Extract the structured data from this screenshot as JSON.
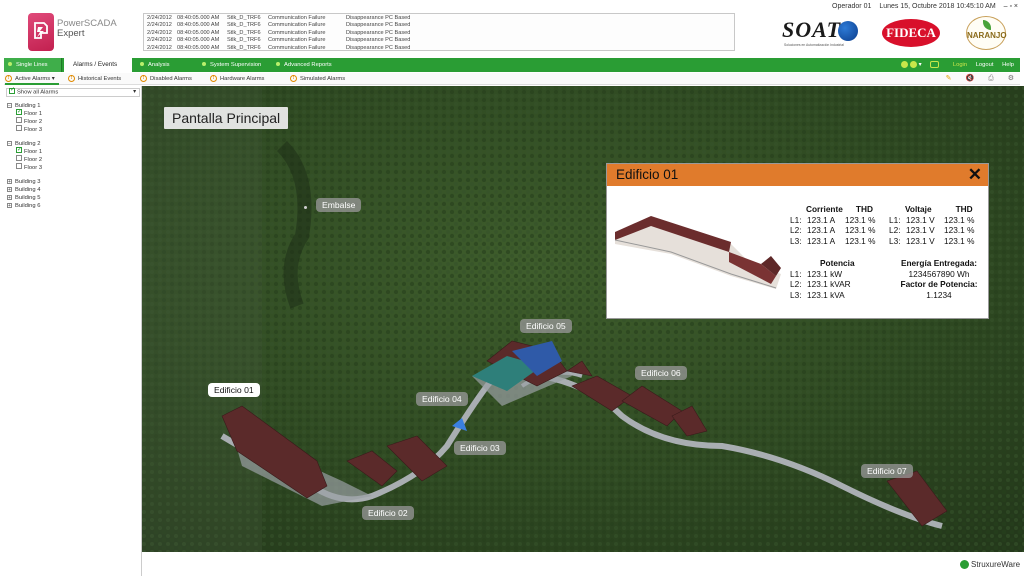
{
  "app": {
    "name_line1": "PowerSCADA",
    "name_line2": "Expert"
  },
  "alarm_log": [
    [
      "2/24/2012",
      "08:40:05.000 AM",
      "Stlk_D_TRF6",
      "Communication Failure",
      "Disappearance PC Based"
    ],
    [
      "2/24/2012",
      "08:40:05.000 AM",
      "Stlk_D_TRF6",
      "Communication Failure",
      "Disappearance PC Based"
    ],
    [
      "2/24/2012",
      "08:40:05.000 AM",
      "Stlk_D_TRF6",
      "Communication Failure",
      "Disappearance PC Based"
    ],
    [
      "2/24/2012",
      "08:40:05.000 AM",
      "Stlk_D_TRF6",
      "Communication Failure",
      "Disappearance PC Based"
    ],
    [
      "2/24/2012",
      "08:40:05.000 AM",
      "Stlk_D_TRF6",
      "Communication Failure",
      "Disappearance PC Based"
    ]
  ],
  "top_info": {
    "operator": "Operador 01",
    "datetime": "Lunes 15, Octubre 2018 10:45:10 AM",
    "window_controls": "– ▫ ×"
  },
  "brands": {
    "soati": "SOATI",
    "soati_sub": "Soluciones en Automatización Industrial",
    "fideca": "FIDECA",
    "naranjo": "NARANJO"
  },
  "main_tabs": [
    {
      "label": "Single Lines"
    },
    {
      "label": "Alarms / Events"
    },
    {
      "label": "Analysis"
    },
    {
      "label": "System Supervision"
    },
    {
      "label": "Advanced Reports"
    }
  ],
  "right_links": {
    "login": "Login",
    "logout": "Logout",
    "help": "Help"
  },
  "sub_tabs": [
    {
      "label": "Active Alarms",
      "icon": "!"
    },
    {
      "label": "Historical Events",
      "icon": "!"
    },
    {
      "label": "Disabled Alarms",
      "icon": "!"
    },
    {
      "label": "Hardware Alarms",
      "icon": "!"
    },
    {
      "label": "Simulated Alarms",
      "icon": "!"
    }
  ],
  "sidebar": {
    "filter_label": "Show all Alarms",
    "buildings": [
      {
        "label": "Building 1",
        "floors": [
          {
            "label": "Floor 1",
            "checked": true
          },
          {
            "label": "Floor 2",
            "checked": false
          },
          {
            "label": "Floor 3",
            "checked": false
          }
        ]
      },
      {
        "label": "Building 2",
        "floors": [
          {
            "label": "Floor 1",
            "checked": true
          },
          {
            "label": "Floor 2",
            "checked": false
          },
          {
            "label": "Floor 3",
            "checked": false
          }
        ]
      },
      {
        "label": "Building 3"
      },
      {
        "label": "Building 4"
      },
      {
        "label": "Building 5"
      },
      {
        "label": "Building 6"
      }
    ]
  },
  "map": {
    "title": "Pantalla Principal",
    "labels": {
      "embalse": "Embalse",
      "e01": "Edificio 01",
      "e02": "Edificio 02",
      "e03": "Edificio 03",
      "e04": "Edificio 04",
      "e05": "Edificio 05",
      "e06": "Edificio 06",
      "e07": "Edificio 07"
    }
  },
  "popup": {
    "title": "Edificio 01",
    "close": "✕",
    "corriente": {
      "header": "Corriente",
      "thd": "THD",
      "rows": [
        [
          "L1:",
          "123.1 A",
          "123.1 %"
        ],
        [
          "L2:",
          "123.1 A",
          "123.1 %"
        ],
        [
          "L3:",
          "123.1 A",
          "123.1 %"
        ]
      ]
    },
    "voltaje": {
      "header": "Voltaje",
      "thd": "THD",
      "rows": [
        [
          "L1:",
          "123.1 V",
          "123.1 %"
        ],
        [
          "L2:",
          "123.1 V",
          "123.1 %"
        ],
        [
          "L3:",
          "123.1 V",
          "123.1 %"
        ]
      ]
    },
    "potencia": {
      "header": "Potencia",
      "rows": [
        [
          "L1:",
          "123.1 kW"
        ],
        [
          "L2:",
          "123.1 kVAR"
        ],
        [
          "L3:",
          "123.1 kVA"
        ]
      ]
    },
    "energia": {
      "header": "Energía Entregada:",
      "value": "1234567890 Wh",
      "fp_header": "Factor de Potencia:",
      "fp_value": "1.1234"
    }
  },
  "footer": {
    "brand": "StruxureWare"
  }
}
